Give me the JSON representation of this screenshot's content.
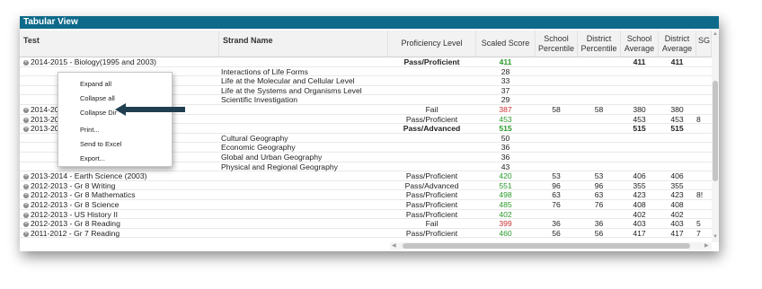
{
  "window": {
    "title": "Tabular View"
  },
  "columns": {
    "test": "Test",
    "strand": "Strand Name",
    "proficiency": "Proficiency Level",
    "scaled": "Scaled Score",
    "school_pct_1": "School",
    "school_pct_2": "Percentile",
    "district_pct_1": "District",
    "district_pct_2": "Percentile",
    "school_avg_1": "School",
    "school_avg_2": "Average",
    "district_avg_1": "District",
    "district_avg_2": "Average",
    "sg": "SG"
  },
  "rows": [
    {
      "test": "2014-2015 - Biology(1995 and 2003)",
      "strand": "",
      "prof": "Pass/Proficient",
      "score": "411",
      "sp": "",
      "dp": "",
      "sa": "411",
      "da": "411",
      "sg": "",
      "bold": true,
      "color": "#2a9a2a",
      "expand": true
    },
    {
      "test": "",
      "strand": "Interactions of Life Forms",
      "prof": "",
      "score": "28",
      "sp": "",
      "dp": "",
      "sa": "",
      "da": "",
      "sg": "",
      "color": "#222"
    },
    {
      "test": "",
      "strand": "Life at the Molecular and Cellular Level",
      "prof": "",
      "score": "33",
      "sp": "",
      "dp": "",
      "sa": "",
      "da": "",
      "sg": "",
      "color": "#222"
    },
    {
      "test": "",
      "strand": "Life at the Systems and Organisms Level",
      "prof": "",
      "score": "37",
      "sp": "",
      "dp": "",
      "sa": "",
      "da": "",
      "sg": "",
      "color": "#222"
    },
    {
      "test": "",
      "strand": "Scientific Investigation",
      "prof": "",
      "score": "29",
      "sp": "",
      "dp": "",
      "sa": "",
      "da": "",
      "sg": "",
      "color": "#222"
    },
    {
      "test": "2014-2015 -",
      "strand": "",
      "prof": "Fail",
      "score": "387",
      "sp": "58",
      "dp": "58",
      "sa": "380",
      "da": "380",
      "sg": "",
      "color": "#d03030",
      "expand": true
    },
    {
      "test": "2013-2014 -",
      "strand": "",
      "prof": "Pass/Proficient",
      "score": "453",
      "sp": "",
      "dp": "",
      "sa": "453",
      "da": "453",
      "sg": "8",
      "color": "#2a9a2a",
      "expand": true
    },
    {
      "test": "2013-2014",
      "strand": "",
      "prof": "Pass/Advanced",
      "score": "515",
      "sp": "",
      "dp": "",
      "sa": "515",
      "da": "515",
      "sg": "",
      "bold": true,
      "color": "#2a9a2a",
      "expand": true
    },
    {
      "test": "",
      "strand": "Cultural Geography",
      "prof": "",
      "score": "50",
      "sp": "",
      "dp": "",
      "sa": "",
      "da": "",
      "sg": "",
      "color": "#222"
    },
    {
      "test": "",
      "strand": "Economic Geography",
      "prof": "",
      "score": "36",
      "sp": "",
      "dp": "",
      "sa": "",
      "da": "",
      "sg": "",
      "color": "#222"
    },
    {
      "test": "",
      "strand": "Global and Urban Geography",
      "prof": "",
      "score": "36",
      "sp": "",
      "dp": "",
      "sa": "",
      "da": "",
      "sg": "",
      "color": "#222"
    },
    {
      "test": "",
      "strand": "Physical and Regional Geography",
      "prof": "",
      "score": "43",
      "sp": "",
      "dp": "",
      "sa": "",
      "da": "",
      "sg": "",
      "color": "#222"
    },
    {
      "test": "2013-2014 - Earth Science (2003)",
      "strand": "",
      "prof": "Pass/Proficient",
      "score": "420",
      "sp": "53",
      "dp": "53",
      "sa": "406",
      "da": "406",
      "sg": "",
      "color": "#2a9a2a",
      "expand": true
    },
    {
      "test": "2012-2013 - Gr 8 Writing",
      "strand": "",
      "prof": "Pass/Advanced",
      "score": "551",
      "sp": "96",
      "dp": "96",
      "sa": "355",
      "da": "355",
      "sg": "",
      "color": "#2a9a2a",
      "expand": true
    },
    {
      "test": "2012-2013 - Gr 8 Mathematics",
      "strand": "",
      "prof": "Pass/Proficient",
      "score": "498",
      "sp": "63",
      "dp": "63",
      "sa": "423",
      "da": "423",
      "sg": "8!",
      "color": "#2a9a2a",
      "expand": true
    },
    {
      "test": "2012-2013 - Gr 8 Science",
      "strand": "",
      "prof": "Pass/Proficient",
      "score": "485",
      "sp": "76",
      "dp": "76",
      "sa": "408",
      "da": "408",
      "sg": "",
      "color": "#2a9a2a",
      "expand": true
    },
    {
      "test": "2012-2013 - US History II",
      "strand": "",
      "prof": "Pass/Proficient",
      "score": "402",
      "sp": "",
      "dp": "",
      "sa": "402",
      "da": "402",
      "sg": "",
      "color": "#2a9a2a",
      "expand": true
    },
    {
      "test": "2012-2013 - Gr 8 Reading",
      "strand": "",
      "prof": "Fail",
      "score": "399",
      "sp": "36",
      "dp": "36",
      "sa": "403",
      "da": "403",
      "sg": "5",
      "color": "#d03030",
      "expand": true
    },
    {
      "test": "2011-2012 - Gr 7 Reading",
      "strand": "",
      "prof": "Pass/Proficient",
      "score": "460",
      "sp": "56",
      "dp": "56",
      "sa": "417",
      "da": "417",
      "sg": "7",
      "color": "#2a9a2a",
      "expand": true
    }
  ],
  "context_menu": {
    "items": [
      "Expand all",
      "Collapse all",
      "Collapse Dir",
      "Print...",
      "Send to Excel",
      "Export..."
    ]
  },
  "colors": {
    "titlebar": "#0e6a8a",
    "pass": "#2a9a2a",
    "fail": "#d03030",
    "arrow": "#1f3f4f"
  }
}
